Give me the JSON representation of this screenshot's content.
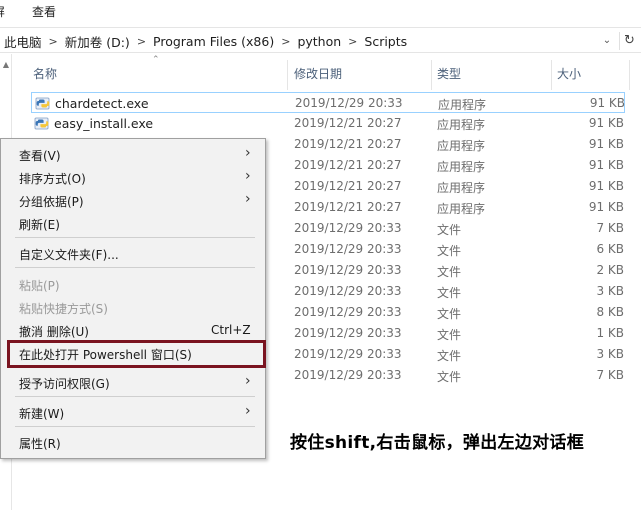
{
  "ribbon": {
    "tabs": [
      "屏",
      "查看"
    ]
  },
  "address": {
    "crumbs": [
      "此电脑",
      "新加卷 (D:)",
      "Program Files (x86)",
      "python",
      "Scripts"
    ]
  },
  "columns": {
    "name": "名称",
    "date": "修改日期",
    "type": "类型",
    "size": "大小"
  },
  "files": [
    {
      "name": "chardetect.exe",
      "date": "2019/12/29 20:33",
      "type": "应用程序",
      "size": "91 KB",
      "icon": "python-exe-icon"
    },
    {
      "name": "easy_install.exe",
      "date": "2019/12/21 20:27",
      "type": "应用程序",
      "size": "91 KB",
      "icon": "python-exe-icon"
    },
    {
      "name": "",
      "date": "2019/12/21 20:27",
      "type": "应用程序",
      "size": "91 KB",
      "icon": ""
    },
    {
      "name": "",
      "date": "2019/12/21 20:27",
      "type": "应用程序",
      "size": "91 KB",
      "icon": ""
    },
    {
      "name": "",
      "date": "2019/12/21 20:27",
      "type": "应用程序",
      "size": "91 KB",
      "icon": ""
    },
    {
      "name": "",
      "date": "2019/12/21 20:27",
      "type": "应用程序",
      "size": "91 KB",
      "icon": ""
    },
    {
      "name": "",
      "date": "2019/12/29 20:33",
      "type": "文件",
      "size": "7 KB",
      "icon": ""
    },
    {
      "name": "",
      "date": "2019/12/29 20:33",
      "type": "文件",
      "size": "6 KB",
      "icon": ""
    },
    {
      "name": "",
      "date": "2019/12/29 20:33",
      "type": "文件",
      "size": "2 KB",
      "icon": ""
    },
    {
      "name": "",
      "date": "2019/12/29 20:33",
      "type": "文件",
      "size": "3 KB",
      "icon": ""
    },
    {
      "name": "",
      "date": "2019/12/29 20:33",
      "type": "文件",
      "size": "8 KB",
      "icon": ""
    },
    {
      "name": "",
      "date": "2019/12/29 20:33",
      "type": "文件",
      "size": "1 KB",
      "icon": ""
    },
    {
      "name": "",
      "date": "2019/12/29 20:33",
      "type": "文件",
      "size": "3 KB",
      "icon": ""
    },
    {
      "name": "",
      "date": "2019/12/29 20:33",
      "type": "文件",
      "size": "7 KB",
      "icon": ""
    }
  ],
  "menu": {
    "view": "查看(V)",
    "sort": "排序方式(O)",
    "group": "分组依据(P)",
    "refresh": "刷新(E)",
    "customize": "自定义文件夹(F)...",
    "paste": "粘贴(P)",
    "paste_shortcut": "粘贴快捷方式(S)",
    "undo": "撤消 删除(U)",
    "undo_shortcut": "Ctrl+Z",
    "powershell": "在此处打开 Powershell 窗口(S)",
    "access": "授予访问权限(G)",
    "new": "新建(W)",
    "properties": "属性(R)"
  },
  "annotation": "按住shift,右击鼠标，弹出左边对话框",
  "colors": {
    "highlight_box": "#7a1420",
    "selection_border": "#99d1ff",
    "header_text": "#4c607a"
  }
}
